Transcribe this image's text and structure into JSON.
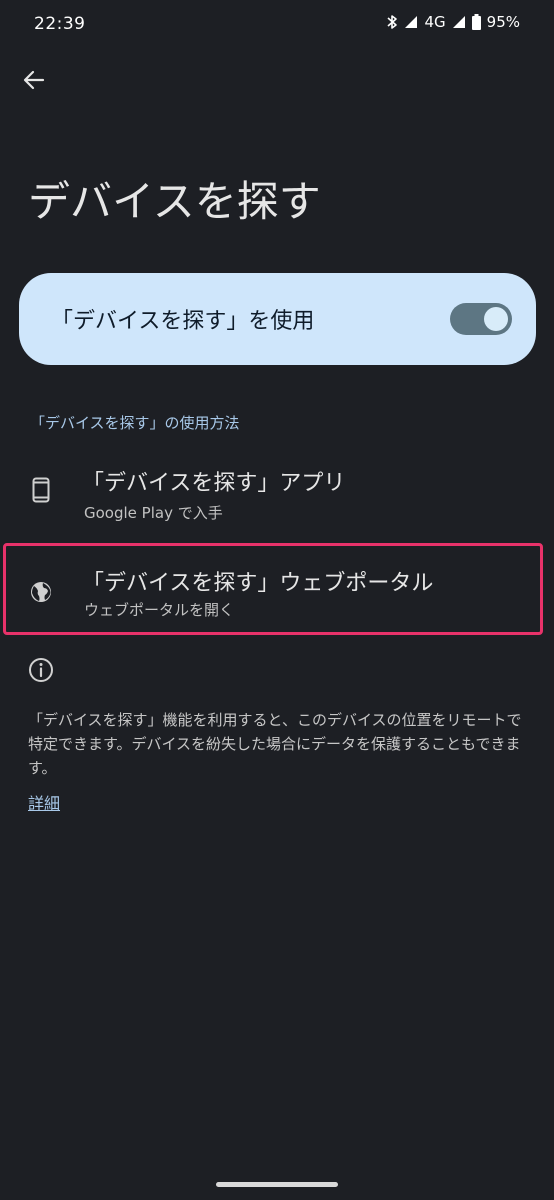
{
  "status_bar": {
    "time": "22:39",
    "network": "4G",
    "battery": "95%",
    "icons": [
      "bluetooth-icon",
      "signal-icon",
      "battery-icon"
    ]
  },
  "header": {
    "back_icon": "arrow-back-icon",
    "title": "デバイスを探す"
  },
  "main_toggle": {
    "label": "「デバイスを探す」を使用",
    "enabled": true
  },
  "section": {
    "header": "「デバイスを探す」の使用方法",
    "options": [
      {
        "title": "「デバイスを探す」アプリ",
        "subtitle": "Google Play で入手",
        "icon": "phone-icon"
      },
      {
        "title": "「デバイスを探す」ウェブポータル",
        "subtitle": "ウェブポータルを開く",
        "icon": "globe-icon"
      }
    ]
  },
  "info": {
    "icon": "info-icon",
    "description": "「デバイスを探す」機能を利用すると、このデバイスの位置をリモートで特定できます。デバイスを紛失した場合にデータを保護することもできます。",
    "learn_more": "詳細"
  },
  "colors": {
    "background": "#1d1f24",
    "toggle_card": "#cfe6fb",
    "accent_text": "#a8c8e8",
    "highlight": "#e8326a"
  }
}
